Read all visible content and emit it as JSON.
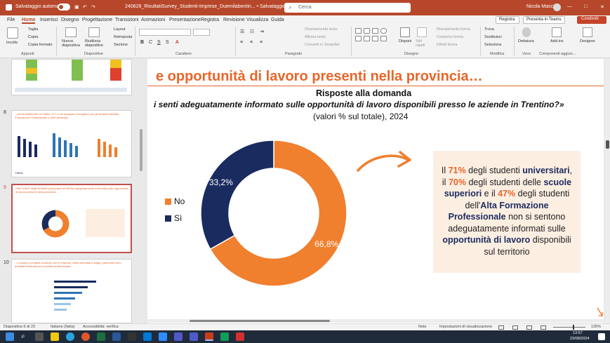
{
  "titlebar": {
    "autosave": "Salvataggio automatico",
    "filename": "240828_RisultatiSurvey_Studenti-Imprese_Duemilabentin... • Salvataggio completato",
    "search": "Cerca",
    "user": "Nicola Mascia",
    "minimize": "—",
    "maximize": "□",
    "close": "✕"
  },
  "menu": {
    "tabs": [
      "File",
      "Home",
      "Inserisci",
      "Disegno",
      "Progettazione",
      "Transizioni",
      "Animazioni",
      "Presentazione",
      "Registra",
      "Revisione",
      "Visualizza",
      "Guida"
    ],
    "registra": "Registra",
    "teams": "Presenta in Teams",
    "share": "Condividi"
  },
  "ribbon": {
    "incolla": "Incolla",
    "taglia": "Taglia",
    "copia": "Copia",
    "copia_formato": "Copia formato",
    "nuova_diapositiva": "Nuova diapositiva",
    "riutilizza": "Riutilizza diapositive",
    "layout": "Layout",
    "reimposta": "Reimposta",
    "sezione": "Sezione",
    "orientamento": "Orientamento testo",
    "allinea": "Allinea testo",
    "converti": "Converti in SmartArt",
    "disponi": "Disponi",
    "stili": "Stili rapidi",
    "riempimento": "Riempimento forma",
    "contorno": "Contorno forma",
    "effetti": "Effetti forma",
    "trova": "Trova",
    "sostituisci": "Sostituisci",
    "seleziona": "Seleziona",
    "dettatura": "Dettatura",
    "addins": "Add-ins",
    "designer": "Designer",
    "groups": {
      "appunti": "Appunti",
      "diapositive": "Diapositive",
      "carattere": "Carattere",
      "paragrafo": "Paragrafo",
      "disegno": "Disegno",
      "modifica": "Modifica",
      "voce": "Voce",
      "componenti": "Componenti aggiun..."
    }
  },
  "thumbnails": {
    "nums": [
      "8",
      "9",
      "10"
    ],
    "t8_title": "...percentualmente nei settori ICT e nel comparto energetico per gli studenti dell'Alta Formazione Professionale e dell'Università",
    "t9_title": "Oltre il 66% degli studenti percepisce un'offerta adeguatamente informata sulle opportunità di lavoro presenti nella provincia...",
    "t10_title": "...e possono progetti condivisi con le imprese, visite aziendali e stage, particolari sono possibili informazioni e positive preferenziate",
    "logo": "TSIRA"
  },
  "slide": {
    "heading": "e opportunità di lavoro presenti nella provincia…",
    "subtitle1": "Risposte alla domanda",
    "subtitle2": "i senti adeguatamente informato sulle opportunità di lavoro disponibili presso le aziende in Trentino?»",
    "subtitle3": "(valori % sul totale), 2024",
    "label_no_pct": "66,8%",
    "label_si_pct": "33,2%",
    "legend": [
      {
        "name": "No",
        "color": "#f07f2e"
      },
      {
        "name": "Sì",
        "color": "#1a2b5f"
      }
    ],
    "callout": {
      "p1": "Il ",
      "v71": "71%",
      "p2": " degli studenti ",
      "univ": "universitari",
      "p3": ", il ",
      "v70": "70%",
      "p4": " degli studenti delle ",
      "scuole": "scuole superiori",
      "p5": " e il ",
      "v47": "47%",
      "p6": " degli studenti dell'",
      "afp": "Alta Formazione Professionale",
      "p7": " non si sentono adeguatamente informati sulle ",
      "opp": "opportunità di lavoro",
      "p8": " disponibili sul territorio"
    },
    "colors": {
      "orange": "#f07f2e",
      "navy": "#1a2b5f",
      "callout_bg": "#fdeee2",
      "accent": "#e8662a"
    }
  },
  "chart_data": {
    "type": "pie",
    "donut": true,
    "categories": [
      "No",
      "Sì"
    ],
    "values": [
      66.8,
      33.2
    ],
    "colors": [
      "#f07f2e",
      "#1a2b5f"
    ],
    "legend_position": "left"
  },
  "status": {
    "slide": "Diapositiva 9 di 23",
    "language": "Italiano (Italia)",
    "accessibility": "Accessibilità: verifica",
    "notes": "Note",
    "view_settings": "Impostazioni di visualizzazione",
    "zoom": "135%"
  },
  "taskbar": {
    "time": "13:57",
    "date": "23/08/2024"
  }
}
